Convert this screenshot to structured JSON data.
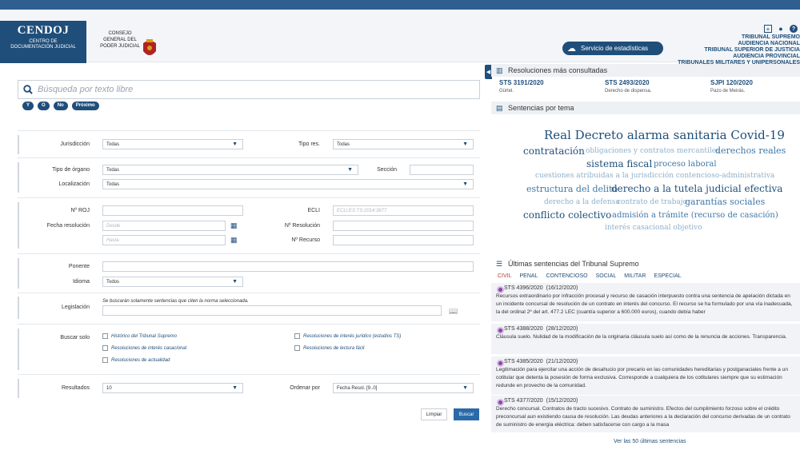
{
  "header": {
    "logo_title": "CENDOJ",
    "logo_sub1": "CENTRO DE",
    "logo_sub2": "DOCUMENTACIÓN JUDICIAL",
    "cgpj_line1": "CONSEJO",
    "cgpj_line2": "GENERAL DEL",
    "cgpj_line3": "PODER JUDICIAL",
    "stats_button": "Servicio de estadísticas",
    "courts": [
      "TRIBUNAL SUPREMO",
      "AUDIENCIA NACIONAL",
      "TRIBUNAL SUPERIOR DE JUSTICIA",
      "AUDIENCIA PROVINCIAL",
      "TRIBUNALES MILITARES Y UNIPERSONALES"
    ],
    "icons": [
      "expand-icon",
      "user-icon",
      "help-icon"
    ]
  },
  "search": {
    "placeholder": "Búsqueda por texto libre",
    "ops": [
      "Y",
      "O",
      "No",
      "Próximo"
    ]
  },
  "form": {
    "jurisdiccion_label": "Jurisdicción",
    "jurisdiccion_value": "Todas",
    "tipo_res_label": "Tipo res.",
    "tipo_res_value": "Todas",
    "tipo_organo_label": "Tipo de órgano",
    "tipo_organo_value": "Todas",
    "seccion_label": "Sección",
    "localizacion_label": "Localización",
    "localizacion_value": "Todas",
    "roj_label": "Nº ROJ",
    "ecli_label": "ECLI",
    "ecli_placeholder": "ECLI:ES:TS:2014:3677",
    "fecha_label": "Fecha resolución",
    "desde_placeholder": "Desde",
    "hasta_placeholder": "Hasta",
    "num_resolucion_label": "Nº Resolución",
    "num_recurso_label": "Nº Recurso",
    "ponente_label": "Ponente",
    "idioma_label": "Idioma",
    "idioma_value": "Todos",
    "legislacion_label": "Legislación",
    "legislacion_note": "Se buscarán solamente sentencias que citen la norma seleccionada.",
    "buscar_solo_label": "Buscar solo",
    "checks": [
      "Histórico del Tribunal Supremo",
      "Resoluciones de interés jurídico (estudios TS)",
      "Resoluciones de interés casacional",
      "Resoluciones de lectura fácil",
      "Resoluciones de actualidad"
    ],
    "resultados_label": "Resultados",
    "resultados_value": "10",
    "ordenar_label": "Ordenar por",
    "ordenar_value": "Fecha Resol. [9..0]",
    "limpiar": "Limpiar",
    "buscar": "Buscar"
  },
  "panel": {
    "mas_consultadas_title": "Resoluciones más consultadas",
    "mas_consultadas": [
      {
        "code": "STS 3191/2020",
        "sub": "Gürtel."
      },
      {
        "code": "STS 2493/2020",
        "sub": "Derecho de dispensa."
      },
      {
        "code": "SJPI 120/2020",
        "sub": "Pazo de Meirás."
      }
    ],
    "por_tema_title": "Sentencias por tema",
    "cloud": [
      "Real Decreto alarma sanitaria Covid-19",
      "contratación",
      "obligaciones y contratos mercantiles",
      "derechos reales",
      "sistema fiscal",
      "proceso laboral",
      "cuestiones atribuidas a la jurisdicción contencioso-administrativa",
      "estructura del delito",
      "derecho a la tutela judicial efectiva",
      "derecho a la defensa",
      "contrato de trabajo",
      "garantías sociales",
      "conflicto colectivo",
      "admisión a trámite (recurso de casación)",
      "interés casacional objetivo"
    ],
    "ultimas_title": "Últimas sentencias del Tribunal Supremo",
    "tabs": [
      "CIVIL",
      "PENAL",
      "CONTENCIOSO",
      "SOCIAL",
      "MILITAR",
      "ESPECIAL"
    ],
    "sentencias": [
      {
        "code": "STS 4396/2020",
        "date": "(16/12/2020)",
        "text": "Recursos extraordinario por infracción procesal y recurso de casación interpuesto contra una sentencia de apelación dictada en un incidente concursal de resolución de un contrato en interés del concurso. El recurso se ha formulado por una vía inadecuada, la del ordinal 2º del art. 477.2 LEC (cuantía superior a 600.000 euros), cuando debía haber"
      },
      {
        "code": "STS 4388/2020",
        "date": "(28/12/2020)",
        "text": "Cláusula suelo. Nulidad de la modificación de la originaria cláusula suelo así como de la renuncia de acciones. Transparencia."
      },
      {
        "code": "STS 4385/2020",
        "date": "(21/12/2020)",
        "text": "Legitimación para ejercitar una acción de desahucio por precario en las comunidades hereditarias y postganaciales frente a un cotitular que detenta la posesión de forma exclusiva. Corresponde a cualquiera de los cotitulares siempre que su estimación redunde en provecho de la comunidad."
      },
      {
        "code": "STS 4377/2020",
        "date": "(15/12/2020)",
        "text": "Derecho concursal. Contratos de tracto sucesivo. Contrato de suministro. Efectos del cumplimiento forzoso sobre el crédito preconcursal aun existiendo causa de resolución. Las deudas anteriores a la declaración del concurso derivadas de un contrato de suministro de energía eléctrica: deben satisfacerse con cargo a la masa"
      }
    ],
    "ver_mas": "Ver las 50 últimas sentencias"
  }
}
